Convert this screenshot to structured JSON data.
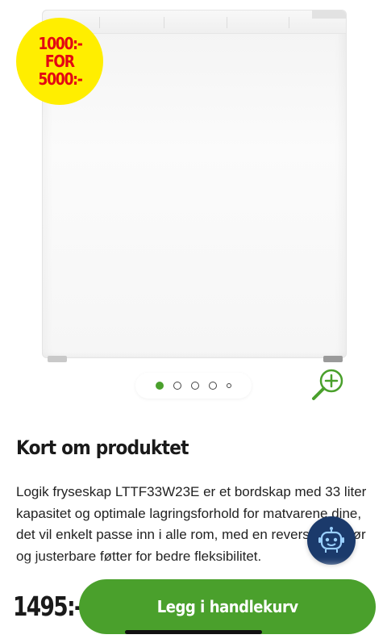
{
  "product": {
    "image_alt": "Logik fryseskap LTTF33W23E",
    "promo_badge": {
      "line1": "1000:-",
      "line2": "FOR",
      "line3": "5000:-"
    },
    "gallery": {
      "image_count": 5,
      "active_index": 0
    },
    "zoom_icon": "zoom-in-icon"
  },
  "summary": {
    "title": "Kort om produktet",
    "text": "Logik fryseskap LTTF33W23E er et bordskap med 33 liter kapasitet og optimale lagringsforhold for matvarene dine, det vil enkelt passe inn i alle rom, med en reverserbar dør og justerbare føtter for bedre fleksibilitet."
  },
  "assistant": {
    "icon": "robot-icon"
  },
  "purchase": {
    "price": "1495:-",
    "cart_button_label": "Legg i handlekurv"
  },
  "colors": {
    "accent_green": "#4aa02c",
    "badge_yellow": "#ffee00",
    "badge_red": "#e30613",
    "assistant_blue": "#1b3a6b"
  }
}
